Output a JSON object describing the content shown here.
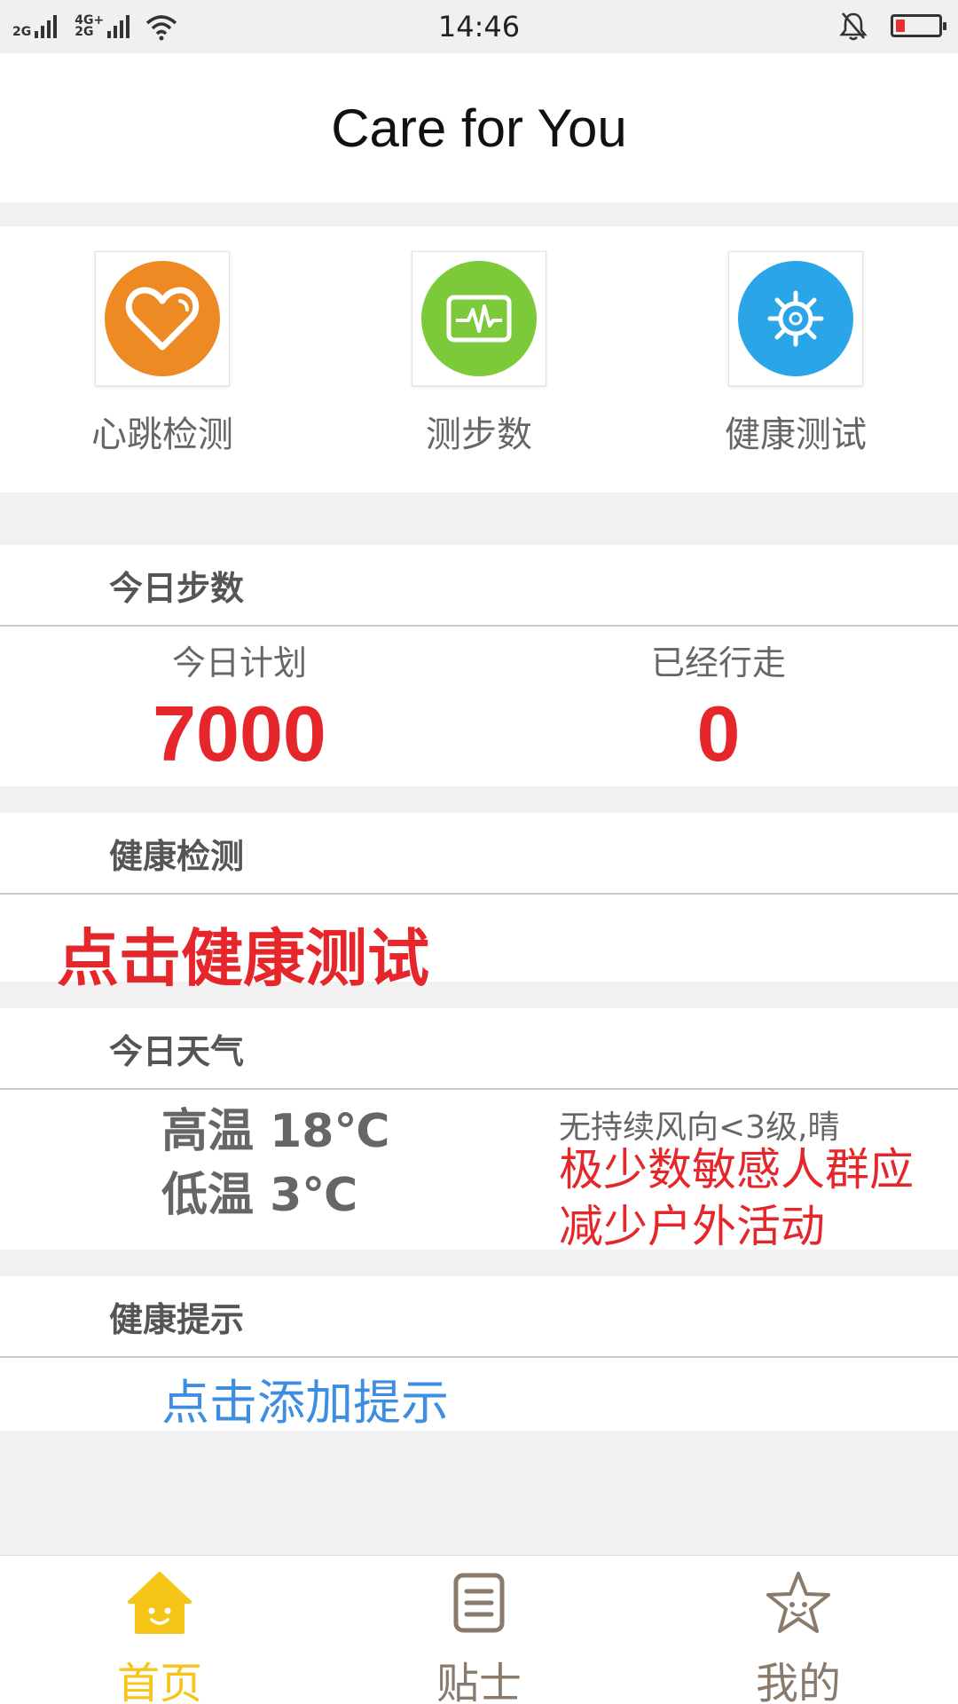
{
  "status_bar": {
    "network_1": "2G",
    "network_2a": "4G+",
    "network_2b": "2G",
    "time": "14:46"
  },
  "header": {
    "title": "Care for You"
  },
  "features": [
    {
      "label": "心跳检测",
      "icon": "heart-icon",
      "color": "#ee8a23"
    },
    {
      "label": "测步数",
      "icon": "pulse-monitor-icon",
      "color": "#7cc93a"
    },
    {
      "label": "健康测试",
      "icon": "gear-icon",
      "color": "#2aa6e8"
    }
  ],
  "steps": {
    "title": "今日步数",
    "plan_label": "今日计划",
    "plan_value": "7000",
    "walked_label": "已经行走",
    "walked_value": "0"
  },
  "health_check": {
    "title": "健康检测",
    "link": "点击健康测试"
  },
  "weather": {
    "title": "今日天气",
    "high": "高温 18℃",
    "low": "低温 3℃",
    "description": "无持续风向<3级,晴",
    "advice": "极少数敏感人群应减少户外活动"
  },
  "tips": {
    "title": "健康提示",
    "link": "点击添加提示"
  },
  "tabbar": [
    {
      "label": "首页",
      "icon": "home-icon",
      "active": true,
      "color": "#f5c518"
    },
    {
      "label": "贴士",
      "icon": "notes-icon",
      "active": false,
      "color": "#8a7a6c"
    },
    {
      "label": "我的",
      "icon": "star-icon",
      "active": false,
      "color": "#8a7a6c"
    }
  ]
}
